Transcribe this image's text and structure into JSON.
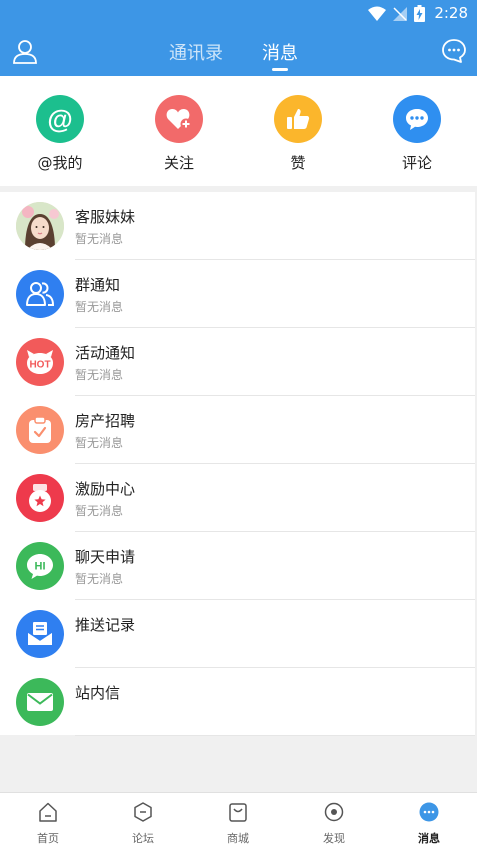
{
  "status_bar": {
    "time": "2:28"
  },
  "header": {
    "tabs": [
      {
        "label": "通讯录"
      },
      {
        "label": "消息"
      }
    ],
    "active_tab": "消息"
  },
  "quick_actions": [
    {
      "label": "@我的",
      "icon": "at-icon",
      "color": "#1cbf8e"
    },
    {
      "label": "关注",
      "icon": "heart-plus-icon",
      "color": "#f26a6a"
    },
    {
      "label": "赞",
      "icon": "thumbs-up-icon",
      "color": "#fbb62c"
    },
    {
      "label": "评论",
      "icon": "comment-bubble-icon",
      "color": "#2f8ff0"
    }
  ],
  "messages": [
    {
      "title": "客服妹妹",
      "subtitle": "暂无消息",
      "icon": "service-girl-avatar"
    },
    {
      "title": "群通知",
      "subtitle": "暂无消息",
      "icon": "group-icon",
      "color": "#2f7ff0"
    },
    {
      "title": "活动通知",
      "subtitle": "暂无消息",
      "icon": "hot-icon",
      "color": "#f25a5a",
      "badge": "HOT"
    },
    {
      "title": "房产招聘",
      "subtitle": "暂无消息",
      "icon": "clipboard-check-icon",
      "color": "#fa8f6e"
    },
    {
      "title": "激励中心",
      "subtitle": "暂无消息",
      "icon": "medal-icon",
      "color": "#ee3a4c"
    },
    {
      "title": "聊天申请",
      "subtitle": "暂无消息",
      "icon": "hi-chat-icon",
      "color": "#3cb95a",
      "badge": "HI"
    },
    {
      "title": "推送记录",
      "subtitle": "",
      "icon": "mail-document-icon",
      "color": "#2f7ff0"
    },
    {
      "title": "站内信",
      "subtitle": "",
      "icon": "envelope-icon",
      "color": "#3cb95a"
    }
  ],
  "bottom_nav": [
    {
      "label": "首页",
      "icon": "home-icon"
    },
    {
      "label": "论坛",
      "icon": "forum-icon"
    },
    {
      "label": "商城",
      "icon": "shopping-bag-icon"
    },
    {
      "label": "发现",
      "icon": "discover-icon"
    },
    {
      "label": "消息",
      "icon": "message-icon",
      "active": true
    }
  ]
}
